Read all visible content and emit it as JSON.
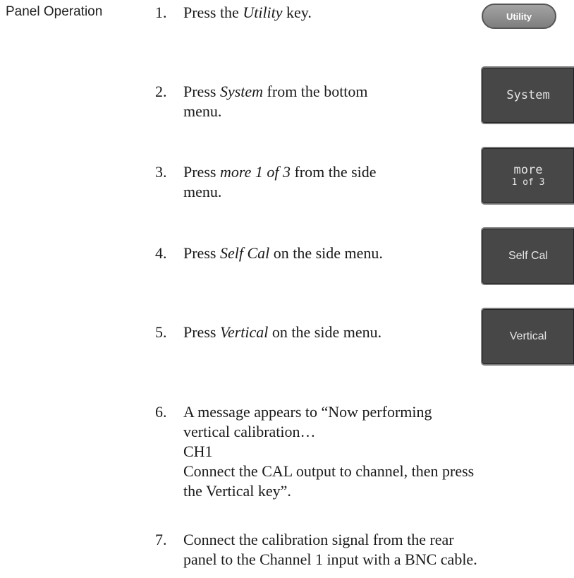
{
  "section_label": "Panel Operation",
  "steps": [
    {
      "num": "1.",
      "pre": "Press the ",
      "em": "Utility",
      "post": " key."
    },
    {
      "num": "2.",
      "pre": "Press ",
      "em": "System",
      "post": " from the bottom",
      "line2": "menu."
    },
    {
      "num": "3.",
      "pre": "Press ",
      "em": "more 1 of 3",
      "post": " from the side",
      "line2": "menu."
    },
    {
      "num": "4.",
      "pre": "Press ",
      "em": "Self Cal",
      "post": " on the side menu."
    },
    {
      "num": "5.",
      "pre": "Press ",
      "em": "Vertical",
      "post": " on the side menu."
    },
    {
      "num": "6.",
      "lines": [
        "A message appears to “Now performing",
        "vertical calibration…",
        "CH1",
        "Connect the CAL output to channel, then press",
        "the Vertical key”."
      ]
    },
    {
      "num": "7.",
      "lines": [
        "Connect the calibration signal from the rear",
        "panel to the Channel 1 input with a BNC cable."
      ]
    }
  ],
  "buttons": {
    "utility": "Utility",
    "system": "System",
    "more_line1": "more",
    "more_line2": "1 of 3",
    "self_cal": "Self Cal",
    "vertical": "Vertical"
  }
}
